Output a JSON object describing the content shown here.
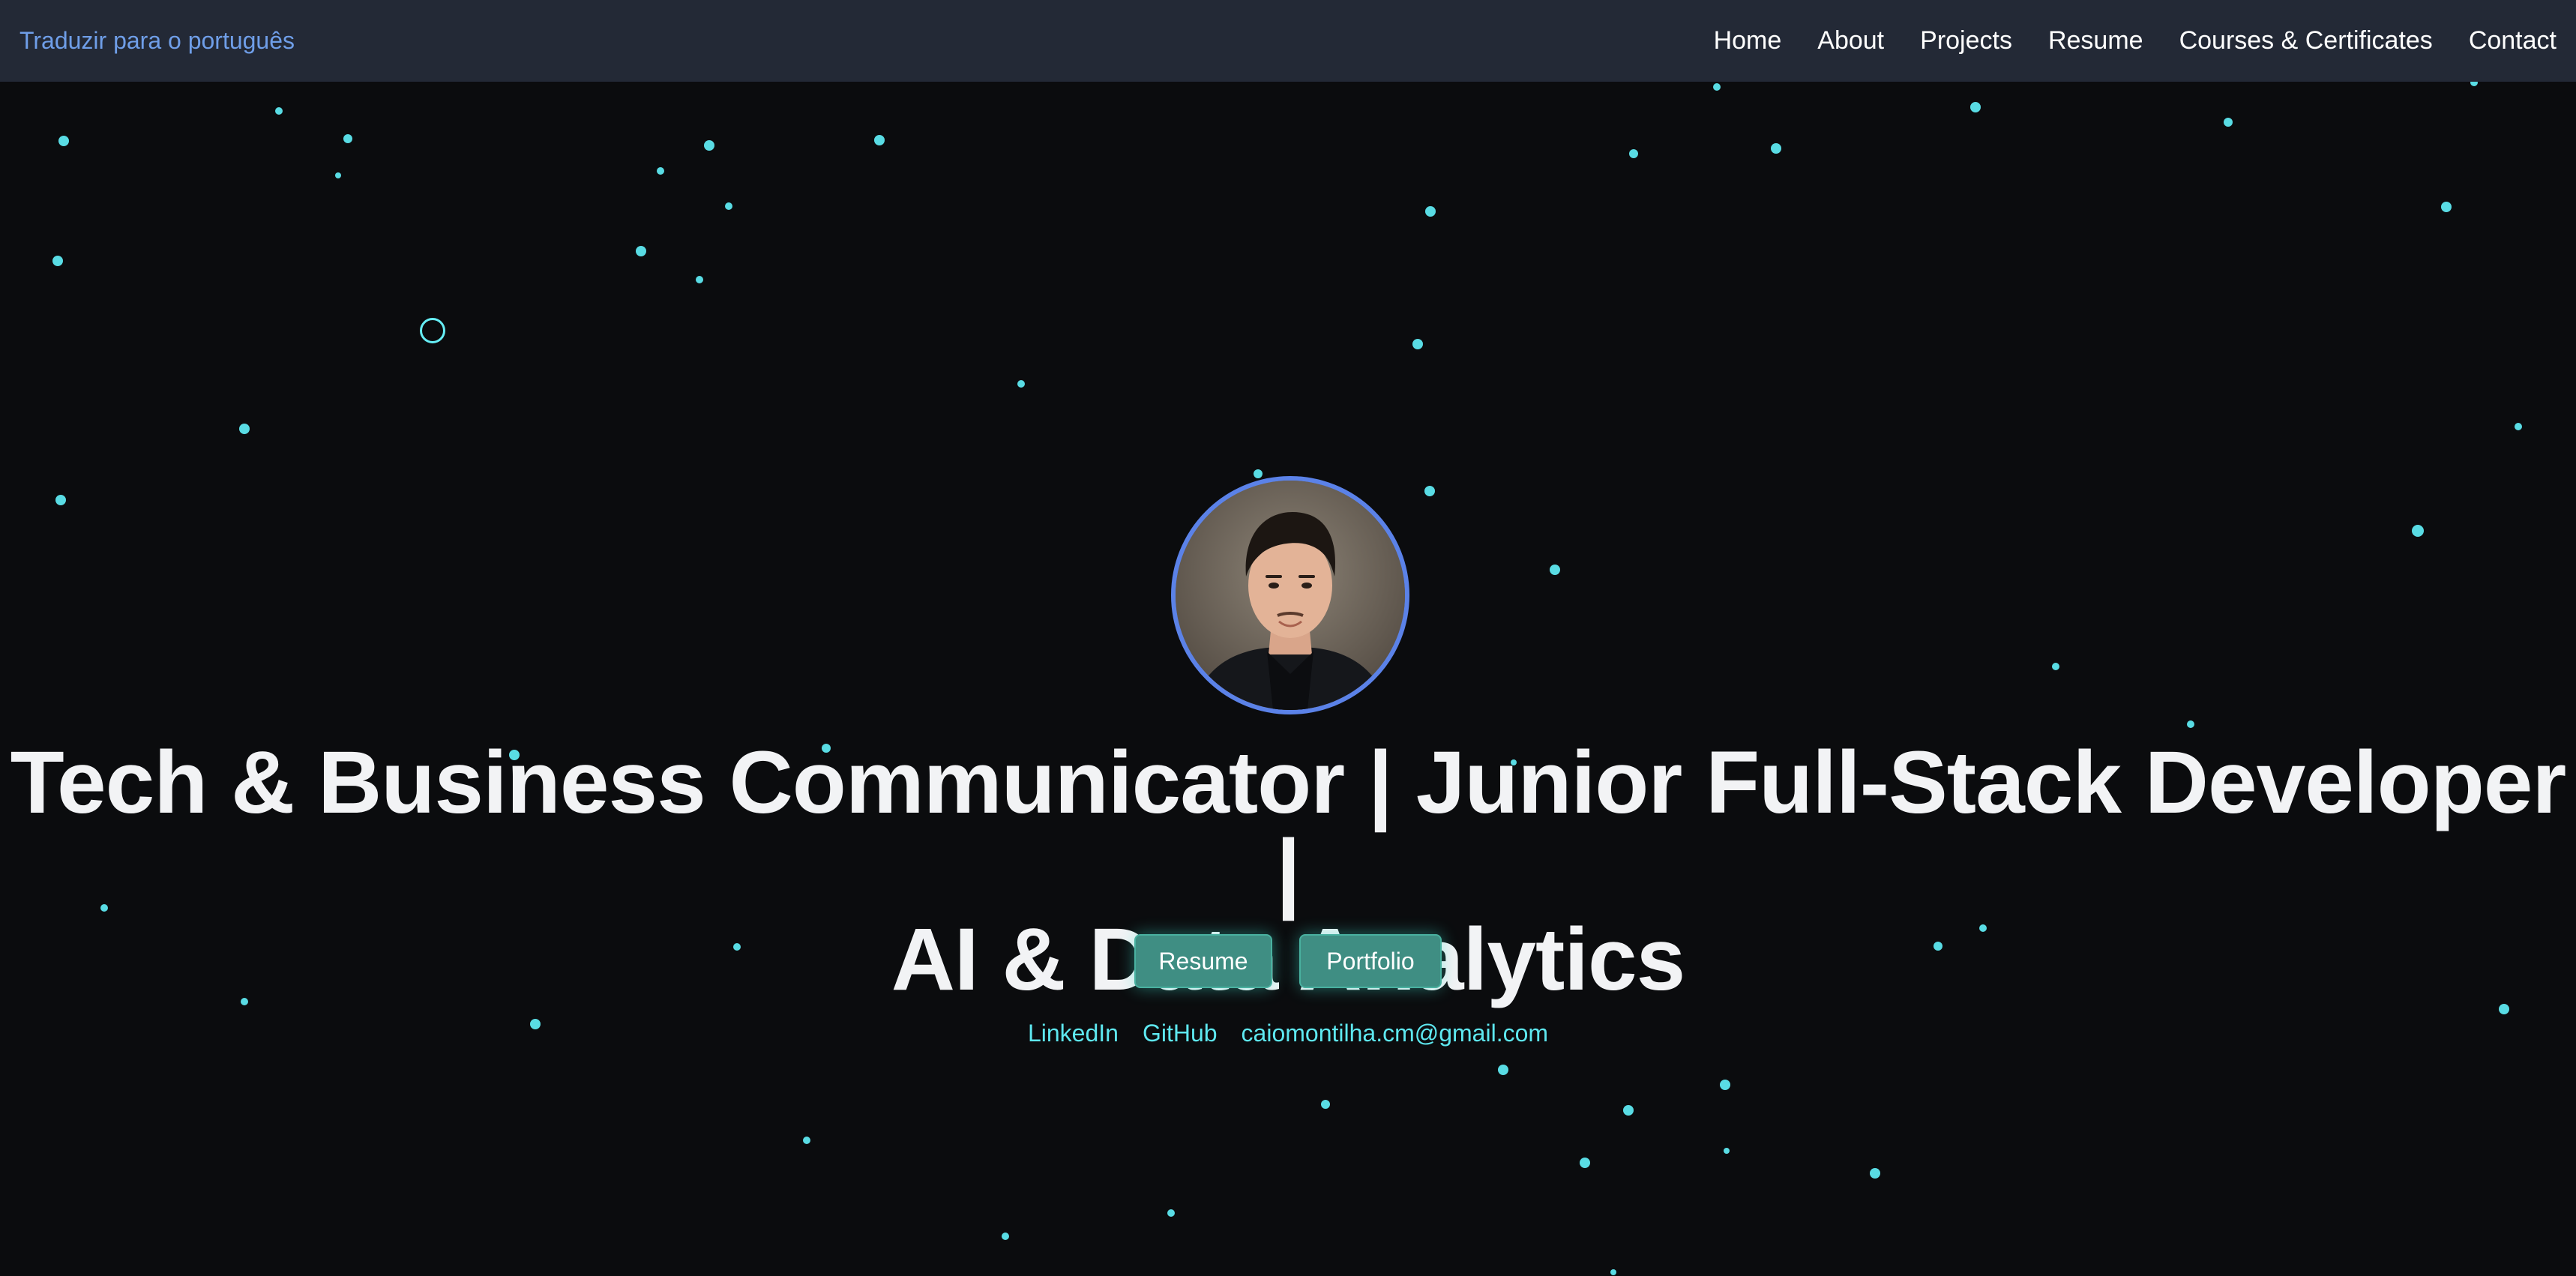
{
  "navbar": {
    "translate_label": "Traduzir para o português",
    "links": [
      "Home",
      "About",
      "Projects",
      "Resume",
      "Courses & Certificates",
      "Contact"
    ]
  },
  "hero": {
    "headline_line1": "Tech & Business Communicator | Junior Full-Stack Developer |",
    "headline_line2": "AI & Data Analytics",
    "buttons": {
      "resume": "Resume",
      "portfolio": "Portfolio"
    },
    "social": {
      "linkedin": "LinkedIn",
      "github": "GitHub",
      "email": "caiomontilha.cm@gmail.com"
    }
  },
  "colors": {
    "background": "#0b0c0e",
    "navbar": "#232936",
    "translate_link": "#6f9ee8",
    "particle": "#5ee8f0",
    "button": "#3f8e83",
    "avatar_border": "#5b82e8"
  },
  "icons": [
    "particle-dot",
    "cursor-ring-icon",
    "profile-photo"
  ]
}
